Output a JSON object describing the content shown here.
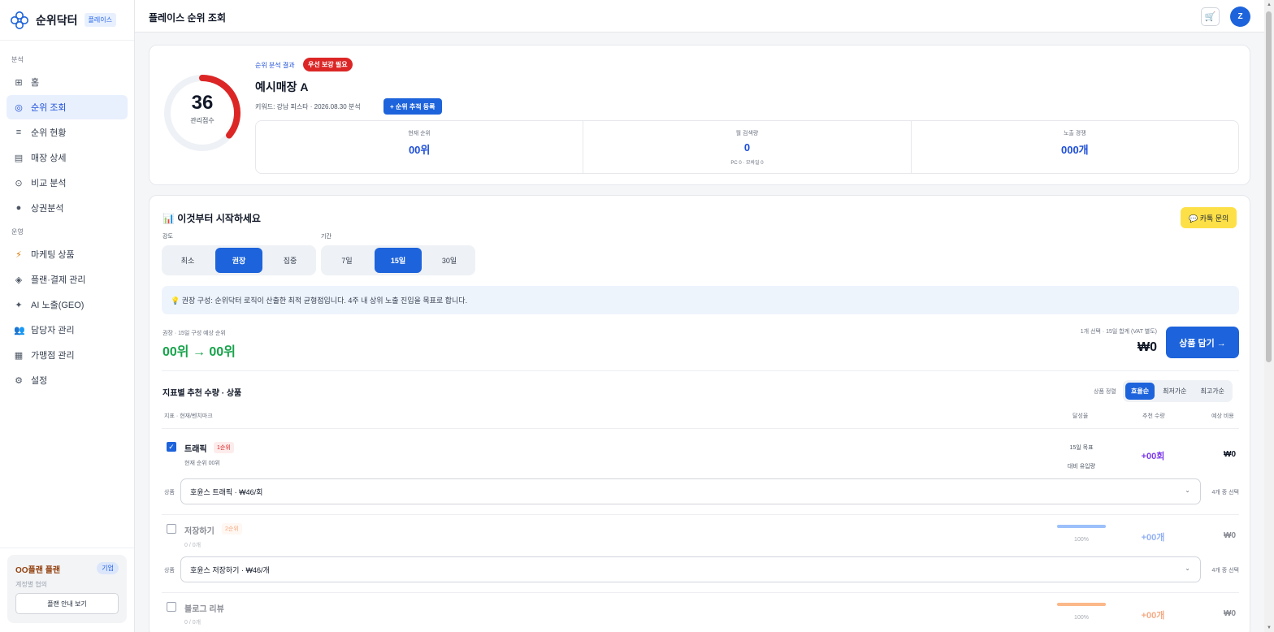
{
  "brand": {
    "name": "순위닥터",
    "badge": "플레이스"
  },
  "sidebar": {
    "section_analysis": "분석",
    "section_ops": "운영",
    "items": [
      {
        "label": "홈",
        "icon": "grid-icon"
      },
      {
        "label": "순위 조회",
        "icon": "target-icon"
      },
      {
        "label": "순위 현황",
        "icon": "list-icon"
      },
      {
        "label": "매장 상세",
        "icon": "store-icon"
      },
      {
        "label": "비교 분석",
        "icon": "compare-icon"
      },
      {
        "label": "상권분석",
        "icon": "dot-icon"
      },
      {
        "label": "마케팅 상품",
        "icon": "lightning-icon"
      },
      {
        "label": "플랜·결제 관리",
        "icon": "diamond-icon"
      },
      {
        "label": "AI 노출(GEO)",
        "icon": "sparkle-icon"
      },
      {
        "label": "담당자 관리",
        "icon": "people-icon"
      },
      {
        "label": "가맹점 관리",
        "icon": "building-icon"
      },
      {
        "label": "설정",
        "icon": "gear-icon"
      }
    ],
    "plan": {
      "name": "OO플랜 플랜",
      "tier": "기업",
      "sub": "계정별 협의",
      "button": "플랜 안내 보기"
    }
  },
  "header": {
    "title": "플레이스 순위 조회",
    "avatar": "Z"
  },
  "result": {
    "score": "36",
    "score_label": "관리점수",
    "score_fraction": 0.36,
    "label": "순위 분석 결과",
    "priority_badge": "우선 보강 필요",
    "store_name": "예시매장 A",
    "keyword_line": "키워드: 강남 피스타 · 2026.08.30 분석",
    "track_button": "+ 순위 추적 등록",
    "stats": [
      {
        "label": "현재 순위",
        "value": "00위",
        "sub": ""
      },
      {
        "label": "월 검색량",
        "value": "0",
        "sub": "PC 0 · 모바일 0"
      },
      {
        "label": "노출 경쟁",
        "value": "000개",
        "sub": ""
      }
    ]
  },
  "start": {
    "title": "📊 이것부터 시작하세요",
    "kakao_button": "💬 카톡 문의",
    "intensity_label": "강도",
    "intensity_options": [
      "최소",
      "권장",
      "집중"
    ],
    "intensity_selected": "권장",
    "period_label": "기간",
    "period_options": [
      "7일",
      "15일",
      "30일"
    ],
    "period_selected": "15일",
    "info": "💡 권장 구성: 순위닥터 로직이 산출한 최적 균형점입니다. 4주 내 상위 노출 진입을 목표로 합니다.",
    "forecast_label": "권장 · 15일 구성 예상 순위",
    "forecast_value": "00위 → 00위",
    "total_label": "1개 선택 · 15일 합계 (VAT 별도)",
    "total_value": "₩0",
    "cart_button": "상품 담기 →"
  },
  "recommend": {
    "title": "지표별 추천 수량 · 상품",
    "sort_label": "상품 정렬",
    "sort_options": [
      "효율순",
      "최저가순",
      "최고가순"
    ],
    "sort_selected": "효율순",
    "headers": {
      "metric": "지표 · 현재/벤치마크",
      "achieve": "달성율",
      "qty": "추천 수량",
      "cost": "예상 비용"
    },
    "product_label": "상품",
    "rows": [
      {
        "name": "트래픽",
        "rank": "1순위",
        "sub": "현재 순위 00위",
        "checked": true,
        "achieve_top": "15일 목표",
        "achieve_bottom": "대비 유입량",
        "qty": "+00회",
        "cost": "₩0",
        "product": "호윤스 트래픽 · ₩46/회",
        "note": "4개 중 선택"
      },
      {
        "name": "저장하기",
        "rank": "2순위",
        "sub": "0 / 0개",
        "checked": false,
        "achieve": "100%",
        "achieve_fraction": 1.0,
        "qty": "+00개",
        "cost": "₩0",
        "product": "호윤스 저장하기 · ₩46/개",
        "note": "4개 중 선택"
      },
      {
        "name": "블로그 리뷰",
        "rank": "",
        "sub": "0 / 0개",
        "checked": false,
        "achieve": "100%",
        "achieve_fraction": 1.0,
        "qty": "+00개",
        "cost": "₩0"
      }
    ]
  },
  "colors": {
    "accent": "#1d63db",
    "gauge": "#dc2626",
    "forecast": "#16a34a",
    "qty": "#7c3aed",
    "kakao": "#fde047"
  }
}
